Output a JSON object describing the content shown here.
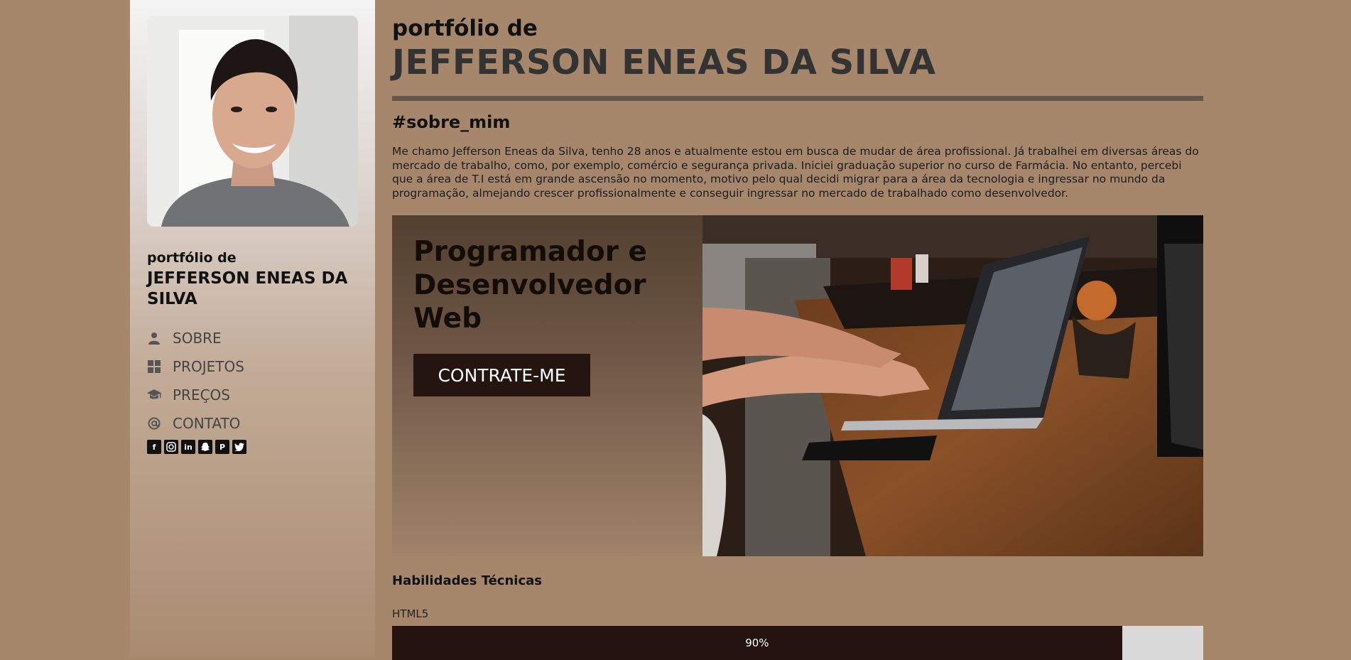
{
  "sidebar": {
    "small_title": "portfólio de",
    "name": "JEFFERSON ENEAS DA SILVA",
    "nav": [
      {
        "label": "SOBRE",
        "icon": "user-icon"
      },
      {
        "label": "PROJETOS",
        "icon": "grid-icon"
      },
      {
        "label": "PREÇOS",
        "icon": "graduation-cap-icon"
      },
      {
        "label": "CONTATO",
        "icon": "at-icon"
      }
    ],
    "socials": [
      "facebook-icon",
      "instagram-icon",
      "linkedin-icon",
      "snapchat-icon",
      "pinterest-icon",
      "twitter-icon"
    ]
  },
  "header": {
    "small_title": "portfólio de",
    "name": "JEFFERSON ENEAS DA SILVA"
  },
  "about": {
    "heading": "#sobre_mim",
    "text": "Me chamo Jefferson Eneas da Silva, tenho 28 anos e atualmente estou em busca de mudar de área profissional. Já trabalhei em diversas áreas do mercado de trabalho, como, por exemplo, comércio e segurança privada. Iniciei graduação superior no curso de Farmácia. No entanto, percebi que a área de T.I está em grande ascensão no momento, motivo pelo qual decidi migrar para a área da tecnologia e ingressar no mundo da programação, almejando crescer profissionalmente e conseguir ingressar no mercado de trabalhado como desenvolvedor."
  },
  "hero": {
    "title": "Programador e Desenvolvedor Web",
    "cta_label": "CONTRATE-ME"
  },
  "skills": {
    "heading": "Habilidades Técnicas",
    "items": [
      {
        "label": "HTML5",
        "percent": 90,
        "percent_label": "90%"
      }
    ]
  },
  "colors": {
    "page_bg": "#a6876c",
    "dark_brown": "#24130e",
    "rule": "#64564b"
  }
}
